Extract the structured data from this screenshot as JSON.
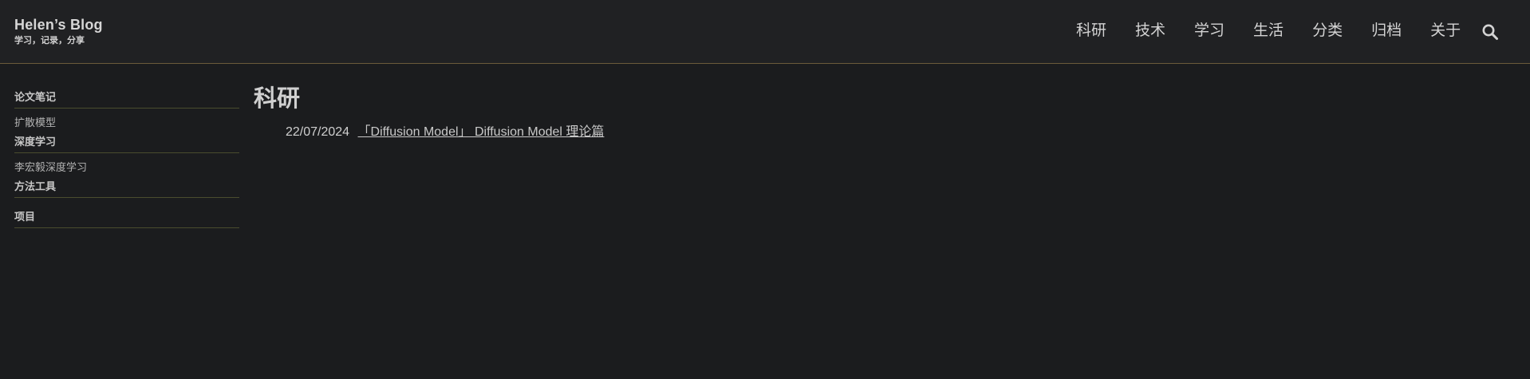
{
  "header": {
    "brand_title": "Helen’s Blog",
    "brand_subtitle": "学习，记录，分享",
    "nav": [
      "科研",
      "技术",
      "学习",
      "生活",
      "分类",
      "归档",
      "关于"
    ],
    "search_icon": "search-icon"
  },
  "sidebar": {
    "sections": [
      {
        "title": "论文笔记",
        "items": [
          "扩散模型"
        ]
      },
      {
        "title": "深度学习",
        "items": [
          "李宏毅深度学习"
        ]
      },
      {
        "title": "方法工具",
        "items": []
      },
      {
        "title": "项目",
        "items": []
      }
    ]
  },
  "main": {
    "title": "科研",
    "posts": [
      {
        "date": "22/07/2024",
        "title": "「Diffusion Model」 Diffusion Model 理论篇"
      }
    ]
  },
  "colors": {
    "background": "#1b1c1e",
    "header_background": "#202123",
    "header_border": "#6b5a3a",
    "sidebar_divider": "#4a4c2e"
  }
}
